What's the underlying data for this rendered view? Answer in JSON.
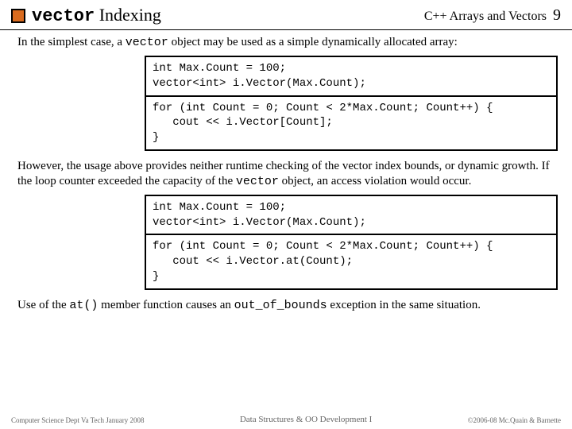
{
  "header": {
    "title_mono": "vector",
    "title_rest": " Indexing",
    "chapter": "C++ Arrays and Vectors",
    "page_number": "9"
  },
  "body": {
    "para1_a": "In the simplest case, a ",
    "para1_mono": "vector",
    "para1_b": " object may be used as a simple dynamically allocated array:",
    "code1_seg1": "int Max.Count = 100;\nvector<int> i.Vector(Max.Count);",
    "code1_seg2": "for (int Count = 0; Count < 2*Max.Count; Count++) {\n   cout << i.Vector[Count];\n}",
    "para2_a": "However, the usage above provides neither runtime checking of the vector index bounds, or dynamic growth.  If the loop counter exceeded the capacity of the ",
    "para2_mono": "vector",
    "para2_b": " object, an access violation would occur.",
    "code2_seg1": "int Max.Count = 100;\nvector<int> i.Vector(Max.Count);",
    "code2_seg2": "for (int Count = 0; Count < 2*Max.Count; Count++) {\n   cout << i.Vector.at(Count);\n}",
    "para3_a": "Use of the ",
    "para3_mono1": "at()",
    "para3_b": " member function causes an ",
    "para3_mono2": "out_of_bounds",
    "para3_c": "  exception in the same situation."
  },
  "footer": {
    "left": "Computer Science Dept Va Tech January 2008",
    "center": "Data Structures & OO Development I",
    "right": "©2006-08  Mc.Quain & Barnette"
  }
}
